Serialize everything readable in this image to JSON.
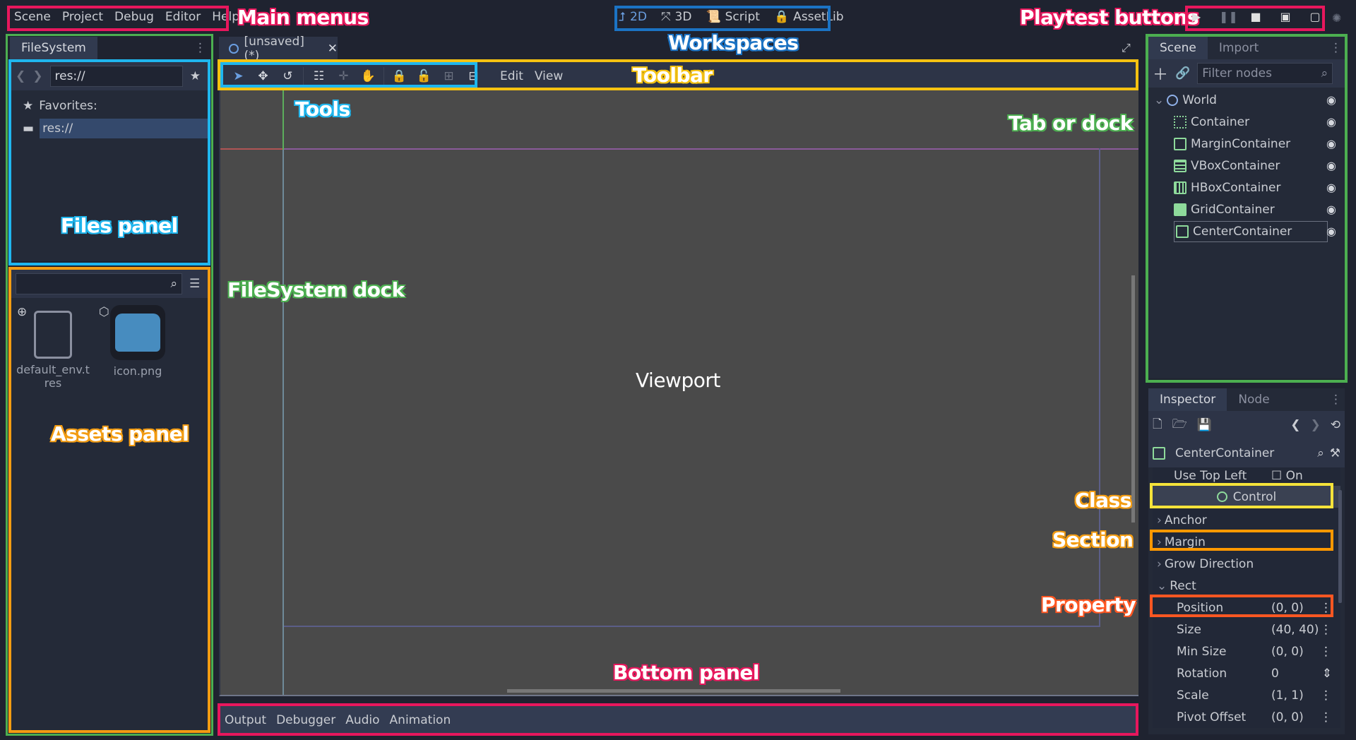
{
  "main_menu": [
    "Scene",
    "Project",
    "Debug",
    "Editor",
    "Help"
  ],
  "workspaces": [
    {
      "label": "2D",
      "icon": "2d-axes-icon",
      "active": true
    },
    {
      "label": "3D",
      "icon": "3d-axes-icon",
      "active": false
    },
    {
      "label": "Script",
      "icon": "script-icon",
      "active": false
    },
    {
      "label": "AssetLib",
      "icon": "assetlib-icon",
      "active": false
    }
  ],
  "playtest": [
    {
      "icon": "play-icon",
      "glyph": "▶"
    },
    {
      "icon": "pause-icon",
      "glyph": "❚❚"
    },
    {
      "icon": "stop-icon",
      "glyph": "■"
    },
    {
      "icon": "play-scene-icon",
      "glyph": "▣"
    },
    {
      "icon": "play-custom-scene-icon",
      "glyph": "▢"
    }
  ],
  "filesystem": {
    "tab": "FileSystem",
    "path": "res://",
    "favorites_label": "Favorites:",
    "root": "res://",
    "files": [
      {
        "name": "default_env.tres",
        "badge": "globe-icon"
      },
      {
        "name": "icon.png",
        "badge": "cube-icon"
      }
    ]
  },
  "scene_tab": {
    "label": "[unsaved](*)",
    "close": "✕"
  },
  "toolbar": {
    "tools": [
      "select",
      "move",
      "rotate",
      "list-select",
      "pivot",
      "pan",
      "lock",
      "unlock",
      "group",
      "ungroup"
    ],
    "menus": [
      "Edit",
      "View"
    ]
  },
  "bottom_tabs": [
    "Output",
    "Debugger",
    "Audio",
    "Animation"
  ],
  "scene_dock": {
    "tabs": [
      "Scene",
      "Import"
    ],
    "filter_placeholder": "Filter nodes",
    "nodes": [
      {
        "name": "World",
        "icon": "node2d-circle-icon",
        "root": true
      },
      {
        "name": "Container",
        "icon": "container-icon"
      },
      {
        "name": "MarginContainer",
        "icon": "margin-container-icon"
      },
      {
        "name": "VBoxContainer",
        "icon": "vbox-container-icon"
      },
      {
        "name": "HBoxContainer",
        "icon": "hbox-container-icon"
      },
      {
        "name": "GridContainer",
        "icon": "grid-container-icon"
      },
      {
        "name": "CenterContainer",
        "icon": "center-container-icon",
        "selected": true
      }
    ]
  },
  "inspector": {
    "tabs": [
      "Inspector",
      "Node"
    ],
    "object": "CenterContainer",
    "use_top_left": {
      "label": "Use Top Left",
      "value": "On"
    },
    "class": "Control",
    "sections": [
      {
        "label": "Anchor",
        "expanded": false
      },
      {
        "label": "Margin",
        "expanded": false
      },
      {
        "label": "Grow Direction",
        "expanded": false
      },
      {
        "label": "Rect",
        "expanded": true
      }
    ],
    "properties": [
      {
        "label": "Position",
        "value": "(0, 0)"
      },
      {
        "label": "Size",
        "value": "(40, 40)"
      },
      {
        "label": "Min Size",
        "value": "(0, 0)"
      },
      {
        "label": "Rotation",
        "value": "0"
      },
      {
        "label": "Scale",
        "value": "(1, 1)"
      },
      {
        "label": "Pivot Offset",
        "value": "(0, 0)"
      }
    ]
  },
  "annotations": {
    "main_menus": "Main menus",
    "workspaces": "Workspaces",
    "playtest": "Playtest buttons",
    "toolbar": "Toolbar",
    "tools": "Tools",
    "tab_or_dock": "Tab or dock",
    "files_panel": "Files panel",
    "filesystem_dock": "FileSystem dock",
    "viewport": "Viewport",
    "assets_panel": "Assets panel",
    "class": "Class",
    "section": "Section",
    "property": "Property",
    "bottom_panel": "Bottom panel"
  },
  "colors": {
    "menu_box": "#e8175d",
    "workspace_box": "#1b73c4",
    "dock_box": "#4caf50",
    "files_box": "#1fb6ee",
    "assets_box": "#f39c12",
    "toolbar_box": "#f5c211",
    "class_box": "#f5e33a",
    "section_box": "#ff9800",
    "property_box": "#ff5722"
  }
}
